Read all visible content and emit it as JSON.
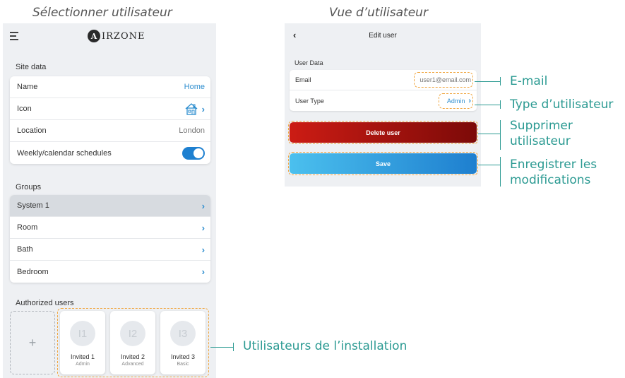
{
  "captions": {
    "left": "Sélectionner utilisateur",
    "right": "Vue d’utilisateur"
  },
  "left_screen": {
    "brand": {
      "initial": "A",
      "name": "IRZONE"
    },
    "site_data": {
      "label": "Site data",
      "rows": [
        {
          "label": "Name",
          "value": "Home"
        },
        {
          "label": "Icon",
          "icon": "house-icon"
        },
        {
          "label": "Location",
          "value": "London"
        },
        {
          "label": "Weekly/calendar schedules",
          "toggle_on": true
        }
      ]
    },
    "groups": {
      "label": "Groups",
      "items": [
        "System 1",
        "Room",
        "Bath",
        "Bedroom"
      ],
      "selected": "System 1"
    },
    "authorized_users": {
      "label": "Authorized users",
      "add_symbol": "+",
      "users": [
        {
          "initials": "I1",
          "name": "Invited 1",
          "role": "Admin"
        },
        {
          "initials": "I2",
          "name": "Invited 2",
          "role": "Advanced"
        },
        {
          "initials": "I3",
          "name": "Invited 3",
          "role": "Basic"
        }
      ]
    }
  },
  "right_screen": {
    "title": "Edit user",
    "user_data_label": "User Data",
    "email": {
      "label": "Email",
      "value": "user1@email.com"
    },
    "user_type": {
      "label": "User Type",
      "value": "Admin"
    },
    "delete_label": "Delete user",
    "save_label": "Save"
  },
  "callouts": {
    "email": "E-mail",
    "user_type": "Type d’utilisateur",
    "delete_line1": "Supprimer",
    "delete_line2": "utilisateur",
    "save_line1": "Enregistrer les",
    "save_line2": "modifications",
    "users": "Utilisateurs de l’installation"
  },
  "colors": {
    "accent_blue": "#2e8ecf",
    "callout_teal": "#2b9a92",
    "highlight_orange": "#f0a640",
    "delete_red": "#cc1c14"
  }
}
